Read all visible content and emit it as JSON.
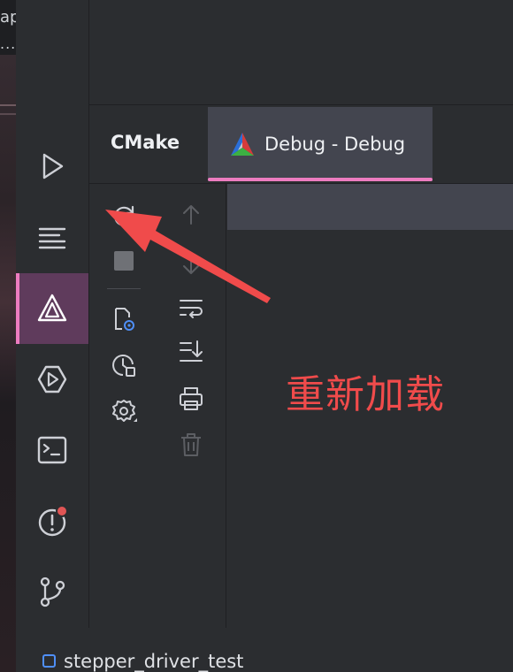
{
  "background_window": {
    "text": "ap",
    "dots": "..."
  },
  "tool_strip": {
    "items": [
      {
        "name": "run",
        "icon": "play-icon"
      },
      {
        "name": "structure",
        "icon": "text-lines-icon"
      },
      {
        "name": "cmake",
        "icon": "cmake-triangle-icon",
        "active": true
      },
      {
        "name": "services",
        "icon": "hexagon-play-icon"
      },
      {
        "name": "terminal",
        "icon": "terminal-icon"
      },
      {
        "name": "problems",
        "icon": "alert-circle-icon",
        "badge": true
      },
      {
        "name": "git",
        "icon": "git-branch-icon"
      }
    ]
  },
  "tabs": {
    "cmake_label": "CMake",
    "active_tab_label": "Debug - Debug"
  },
  "toolbar_left": [
    "reload-icon",
    "stop-icon",
    "cmake-settings-icon",
    "cmake-cache-icon",
    "settings-icon"
  ],
  "toolbar_right": [
    "arrow-up-icon",
    "arrow-down-icon",
    "soft-wrap-icon",
    "scroll-to-end-icon",
    "print-icon",
    "trash-icon"
  ],
  "annotation": {
    "text": "重新加载",
    "color": "#f04b4b"
  },
  "status_bar": {
    "project_name": "stepper_driver_test"
  },
  "colors": {
    "accent": "#ed7cc0",
    "active_bg": "#5f3b5c",
    "tab_active_bg": "#43454f",
    "badge": "#e05555"
  }
}
